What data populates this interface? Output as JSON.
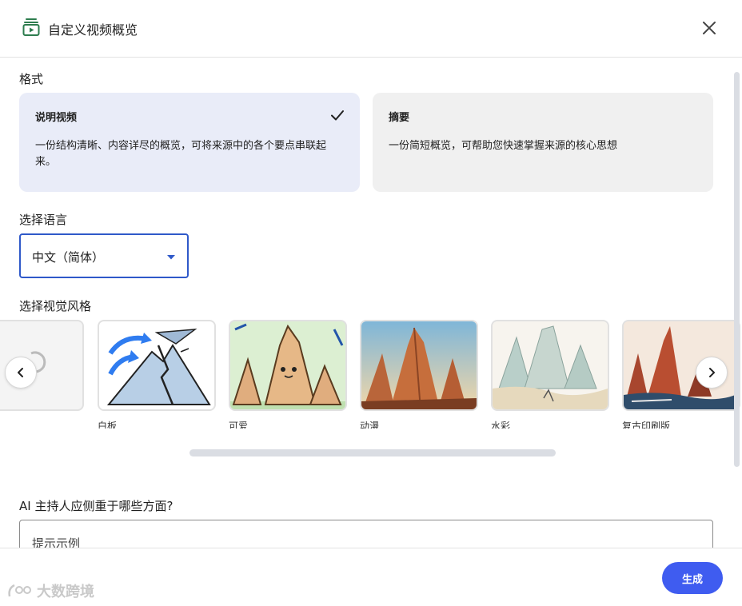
{
  "header": {
    "title": "自定义视频概览",
    "icon": "video-overview-icon",
    "close_icon": "close-icon"
  },
  "format": {
    "label": "格式",
    "options": [
      {
        "title": "说明视频",
        "description": "一份结构清晰、内容详尽的概览，可将来源中的各个要点串联起来。",
        "selected": true
      },
      {
        "title": "摘要",
        "description": "一份简短概览，可帮助您快速掌握来源的核心思想",
        "selected": false
      }
    ]
  },
  "language": {
    "label": "选择语言",
    "selected": "中文（简体）"
  },
  "visual_style": {
    "label": "选择视觉风格",
    "items": [
      {
        "label": ""
      },
      {
        "label": "白板"
      },
      {
        "label": "可爱"
      },
      {
        "label": "动漫"
      },
      {
        "label": "水彩"
      },
      {
        "label": "复古印刷版"
      }
    ]
  },
  "focus": {
    "label": "AI 主持人应侧重于哪些方面?",
    "placeholder": "提示示例"
  },
  "footer": {
    "generate_label": "生成",
    "watermark": "大数跨境"
  },
  "colors": {
    "accent": "#3f5cf0",
    "select_border": "#2f59c9",
    "selected_card": "#e9ecf8"
  }
}
